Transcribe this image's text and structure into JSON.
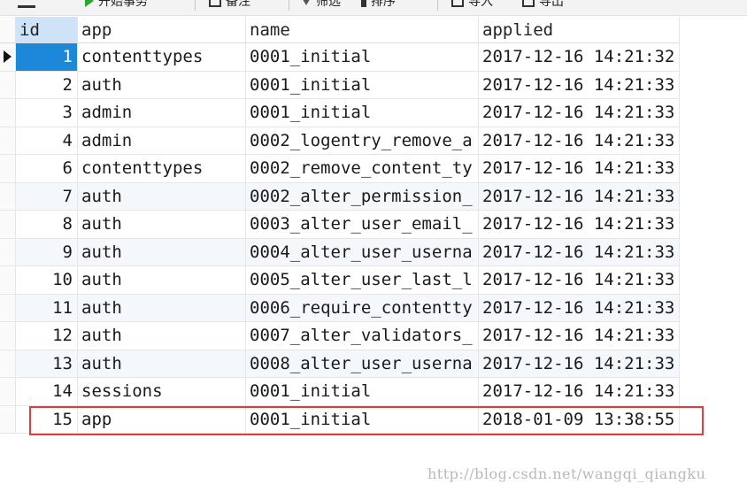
{
  "toolbar": {
    "items": [
      {
        "label": "开始事务",
        "icon": "begin-transaction-icon"
      },
      {
        "label": "备注",
        "icon": "note-icon"
      },
      {
        "label": "筛选",
        "icon": "filter-icon"
      },
      {
        "label": "排序",
        "icon": "sort-icon"
      },
      {
        "label": "导入",
        "icon": "import-icon"
      },
      {
        "label": "导出",
        "icon": "export-icon"
      }
    ]
  },
  "grid": {
    "columns": [
      "id",
      "app",
      "name",
      "applied"
    ],
    "selected_row": 0,
    "highlighted_row": 13,
    "rows": [
      {
        "id": "1",
        "app": "contenttypes",
        "name": "0001_initial",
        "applied": "2017-12-16 14:21:32"
      },
      {
        "id": "2",
        "app": "auth",
        "name": "0001_initial",
        "applied": "2017-12-16 14:21:33"
      },
      {
        "id": "3",
        "app": "admin",
        "name": "0001_initial",
        "applied": "2017-12-16 14:21:33"
      },
      {
        "id": "4",
        "app": "admin",
        "name": "0002_logentry_remove_a",
        "applied": "2017-12-16 14:21:33"
      },
      {
        "id": "6",
        "app": "contenttypes",
        "name": "0002_remove_content_ty",
        "applied": "2017-12-16 14:21:33"
      },
      {
        "id": "7",
        "app": "auth",
        "name": "0002_alter_permission_",
        "applied": "2017-12-16 14:21:33"
      },
      {
        "id": "8",
        "app": "auth",
        "name": "0003_alter_user_email_",
        "applied": "2017-12-16 14:21:33"
      },
      {
        "id": "9",
        "app": "auth",
        "name": "0004_alter_user_userna",
        "applied": "2017-12-16 14:21:33"
      },
      {
        "id": "10",
        "app": "auth",
        "name": "0005_alter_user_last_l",
        "applied": "2017-12-16 14:21:33"
      },
      {
        "id": "11",
        "app": "auth",
        "name": "0006_require_contentty",
        "applied": "2017-12-16 14:21:33"
      },
      {
        "id": "12",
        "app": "auth",
        "name": "0007_alter_validators_",
        "applied": "2017-12-16 14:21:33"
      },
      {
        "id": "13",
        "app": "auth",
        "name": "0008_alter_user_userna",
        "applied": "2017-12-16 14:21:33"
      },
      {
        "id": "14",
        "app": "sessions",
        "name": "0001_initial",
        "applied": "2017-12-16 14:21:33"
      },
      {
        "id": "15",
        "app": "app",
        "name": "0001_initial",
        "applied": "2018-01-09 13:38:55"
      }
    ]
  },
  "watermark": "http://blog.csdn.net/wangqi_qiangku",
  "colors": {
    "selection": "#1e88d8",
    "highlight_border": "#e03c3c"
  }
}
